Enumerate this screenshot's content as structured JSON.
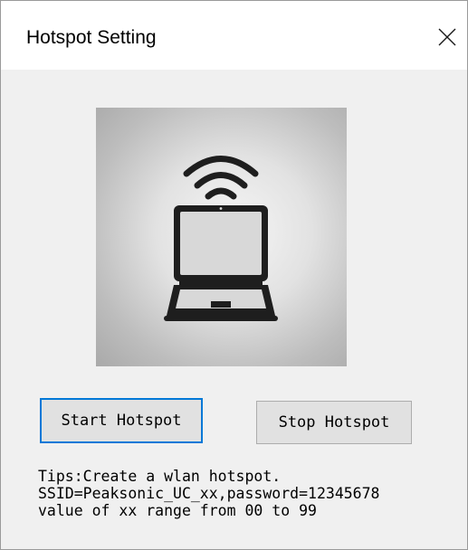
{
  "window": {
    "title": "Hotspot Setting",
    "close_icon": "close-icon"
  },
  "illustration": {
    "icon": "laptop-wifi-icon"
  },
  "buttons": {
    "start_label": "Start Hotspot",
    "stop_label": "Stop Hotspot"
  },
  "tips": {
    "line1": "Tips:Create a wlan hotspot.",
    "line2": "SSID=Peaksonic_UC_xx,password=12345678",
    "line3": "value of xx range from 00 to 99"
  },
  "colors": {
    "focus_border": "#0078d7",
    "button_face": "#e1e1e1",
    "dialog_background": "#f0f0f0"
  }
}
